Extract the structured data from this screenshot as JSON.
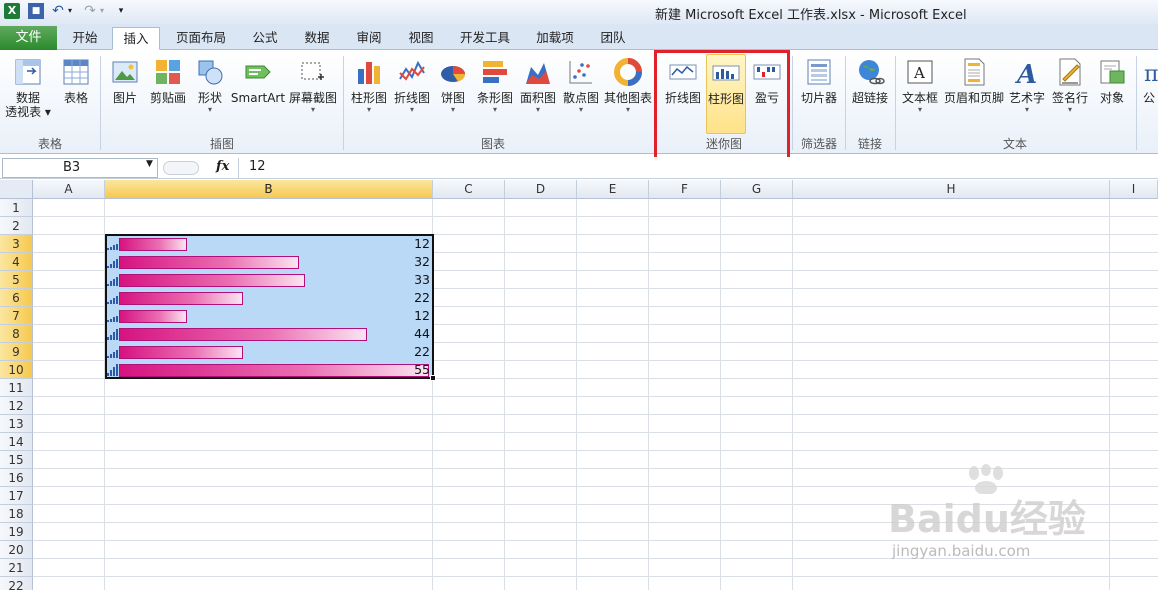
{
  "title": "新建 Microsoft Excel 工作表.xlsx  -  Microsoft Excel",
  "app_icon_text": "X",
  "tabs": [
    "开始",
    "插入",
    "页面布局",
    "公式",
    "数据",
    "审阅",
    "视图",
    "开发工具",
    "加载项",
    "团队"
  ],
  "file_tab": "文件",
  "ribbon": {
    "groups": [
      "表格",
      "插图",
      "图表",
      "迷你图",
      "筛选器",
      "链接",
      "文本"
    ],
    "buttons": {
      "pivot_l1": "数据",
      "pivot_l2": "透视表",
      "table": "表格",
      "picture": "图片",
      "clipart": "剪贴画",
      "shapes": "形状",
      "smartart": "SmartArt",
      "screenshot": "屏幕截图",
      "column": "柱形图",
      "line": "折线图",
      "pie": "饼图",
      "bar": "条形图",
      "area": "面积图",
      "scatter": "散点图",
      "other": "其他图表",
      "spark_line": "折线图",
      "spark_column": "柱形图",
      "spark_winloss": "盈亏",
      "slicer": "切片器",
      "hyperlink": "超链接",
      "textbox": "文本框",
      "headerfooter": "页眉和页脚",
      "wordart": "艺术字",
      "signature": "签名行",
      "object": "对象",
      "equation": "公"
    }
  },
  "formula_bar": {
    "name_box": "B3",
    "fx": "fx",
    "value": "12"
  },
  "columns": [
    "A",
    "B",
    "C",
    "D",
    "E",
    "F",
    "G",
    "H",
    "I"
  ],
  "rows": [
    "1",
    "2",
    "3",
    "4",
    "5",
    "6",
    "7",
    "8",
    "9",
    "10",
    "11",
    "12",
    "13",
    "14",
    "15",
    "16",
    "17",
    "18",
    "19",
    "20",
    "21",
    "22"
  ],
  "cells": {
    "B3": "12",
    "B4": "32",
    "B5": "33",
    "B6": "22",
    "B7": "12",
    "B8": "44",
    "B9": "22",
    "B10": "55"
  },
  "data_bars": [
    12,
    32,
    33,
    22,
    12,
    44,
    22,
    55
  ],
  "data_bar_max": 55,
  "watermark": {
    "logo": "Baidu经验",
    "url": "jingyan.baidu.com"
  },
  "colors": {
    "accent": "#1d7a37",
    "highlight": "#e0202a",
    "data_bar": "#d61380",
    "selection": "#b9d9f6"
  }
}
